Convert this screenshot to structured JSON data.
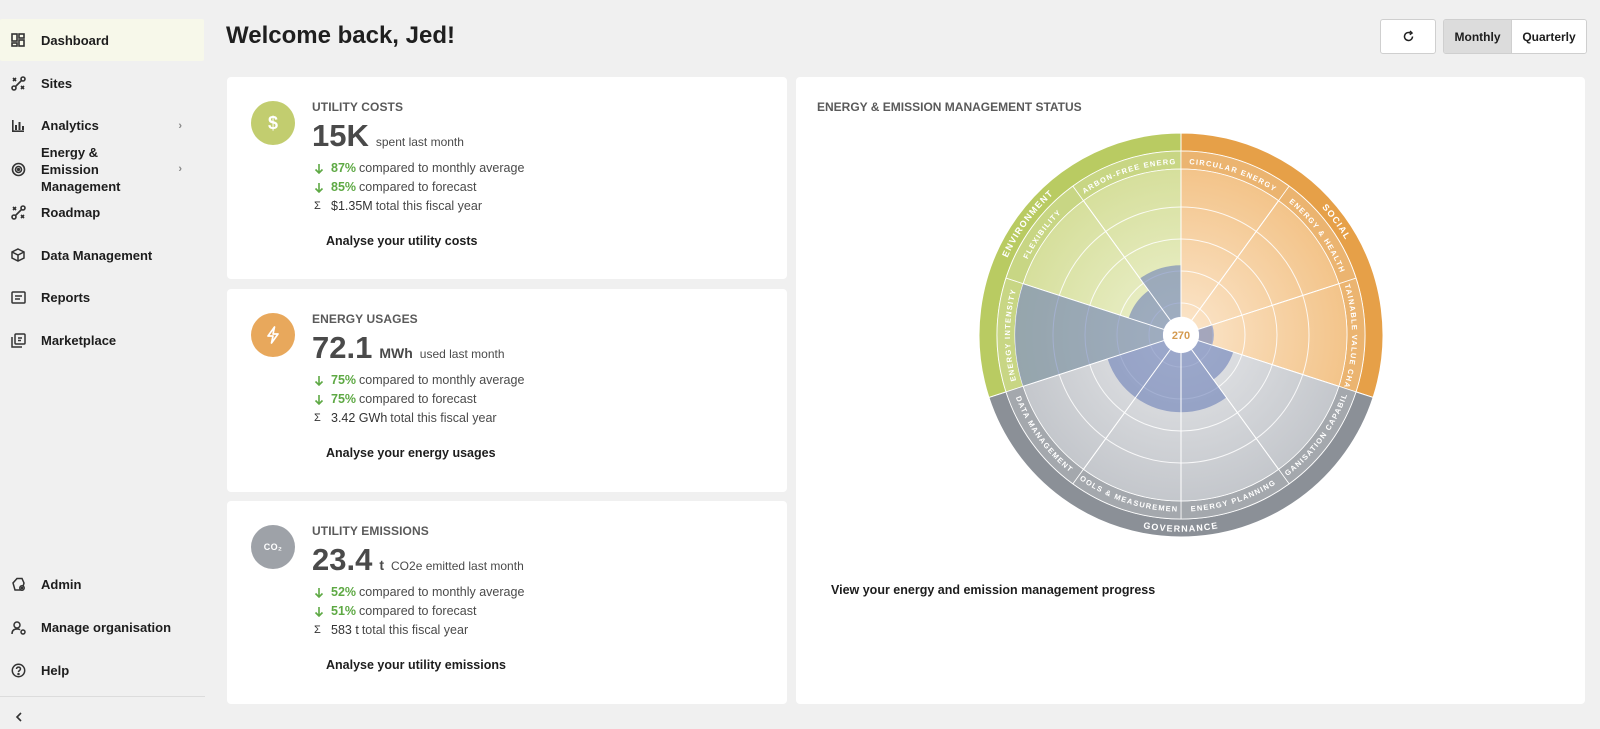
{
  "sidebar": {
    "items": [
      {
        "label": "Dashboard",
        "icon": "dashboard-icon"
      },
      {
        "label": "Sites",
        "icon": "sites-icon"
      },
      {
        "label": "Analytics",
        "icon": "analytics-icon"
      },
      {
        "label": "Energy & Emission Management",
        "icon": "target-icon"
      },
      {
        "label": "Roadmap",
        "icon": "roadmap-icon"
      },
      {
        "label": "Data Management",
        "icon": "cube-icon"
      },
      {
        "label": "Reports",
        "icon": "reports-icon"
      },
      {
        "label": "Marketplace",
        "icon": "marketplace-icon"
      }
    ],
    "bottom_items": [
      {
        "label": "Admin",
        "icon": "admin-icon"
      },
      {
        "label": "Manage organisation",
        "icon": "manage-org-icon"
      },
      {
        "label": "Help",
        "icon": "help-icon"
      }
    ]
  },
  "header": {
    "title": "Welcome back, Jed!",
    "period_options": [
      "Monthly",
      "Quarterly"
    ],
    "selected_period": "Monthly"
  },
  "cards": [
    {
      "heading": "UTILITY COSTS",
      "icon_glyph": "$",
      "icon_color": "#c2cd6f",
      "value": "15K",
      "unit": "",
      "suffix": "spent last month",
      "comparisons": [
        {
          "pct": "87%",
          "text": "compared to monthly average"
        },
        {
          "pct": "85%",
          "text": "compared to forecast"
        }
      ],
      "total_value": "$1.35M",
      "total_text": "total this fiscal year",
      "link": "Analyse your utility costs"
    },
    {
      "heading": "ENERGY USAGES",
      "icon_glyph": "⚡",
      "icon_color": "#e8a85c",
      "value": "72.1",
      "unit": "MWh",
      "suffix": "used last month",
      "comparisons": [
        {
          "pct": "75%",
          "text": "compared to monthly average"
        },
        {
          "pct": "75%",
          "text": "compared to forecast"
        }
      ],
      "total_value": "3.42 GWh",
      "total_text": "total this fiscal year",
      "link": "Analyse your energy usages"
    },
    {
      "heading": "UTILITY EMISSIONS",
      "icon_glyph": "CO₂",
      "icon_color": "#9ea2a8",
      "value": "23.4",
      "unit": "t",
      "suffix": "CO2e emitted last month",
      "comparisons": [
        {
          "pct": "52%",
          "text": "compared to monthly average"
        },
        {
          "pct": "51%",
          "text": "compared to forecast"
        }
      ],
      "total_value": "583 t",
      "total_text": "total this fiscal year",
      "link": "Analyse your utility emissions"
    }
  ],
  "status": {
    "heading": "ENERGY & EMISSION MANAGEMENT STATUS",
    "center_value": "270",
    "groups": [
      {
        "label": "ENVIRONMENT",
        "color": "#b9cb62"
      },
      {
        "label": "SOCIAL",
        "color": "#e6a048"
      },
      {
        "label": "GOVERNANCE",
        "color": "#8b9097"
      }
    ],
    "segments": [
      {
        "label": "CARBON-FREE ENERGY",
        "group": "ENVIRONMENT",
        "score": 0.35
      },
      {
        "label": "FLEXIBILITY",
        "group": "ENVIRONMENT",
        "score": 0.25
      },
      {
        "label": "ENERGY INTENSITY",
        "group": "ENVIRONMENT",
        "score": 1.0
      },
      {
        "label": "CIRCULAR ENERGY",
        "group": "SOCIAL",
        "score": 0
      },
      {
        "label": "ENERGY & HEALTH",
        "group": "SOCIAL",
        "score": 0
      },
      {
        "label": "SUSTAINABLE VALUE CHAINS",
        "group": "SOCIAL",
        "score": 0.1
      },
      {
        "label": "ORGANISATION CAPABILITY",
        "group": "GOVERNANCE",
        "score": 0.25
      },
      {
        "label": "ENERGY PLANNING",
        "group": "GOVERNANCE",
        "score": 0.4
      },
      {
        "label": "TOOLS & MEASUREMENT",
        "group": "GOVERNANCE",
        "score": 0.4
      },
      {
        "label": "DATA MANAGEMENT",
        "group": "GOVERNANCE",
        "score": 0.4
      }
    ],
    "link": "View your energy and emission management progress"
  }
}
